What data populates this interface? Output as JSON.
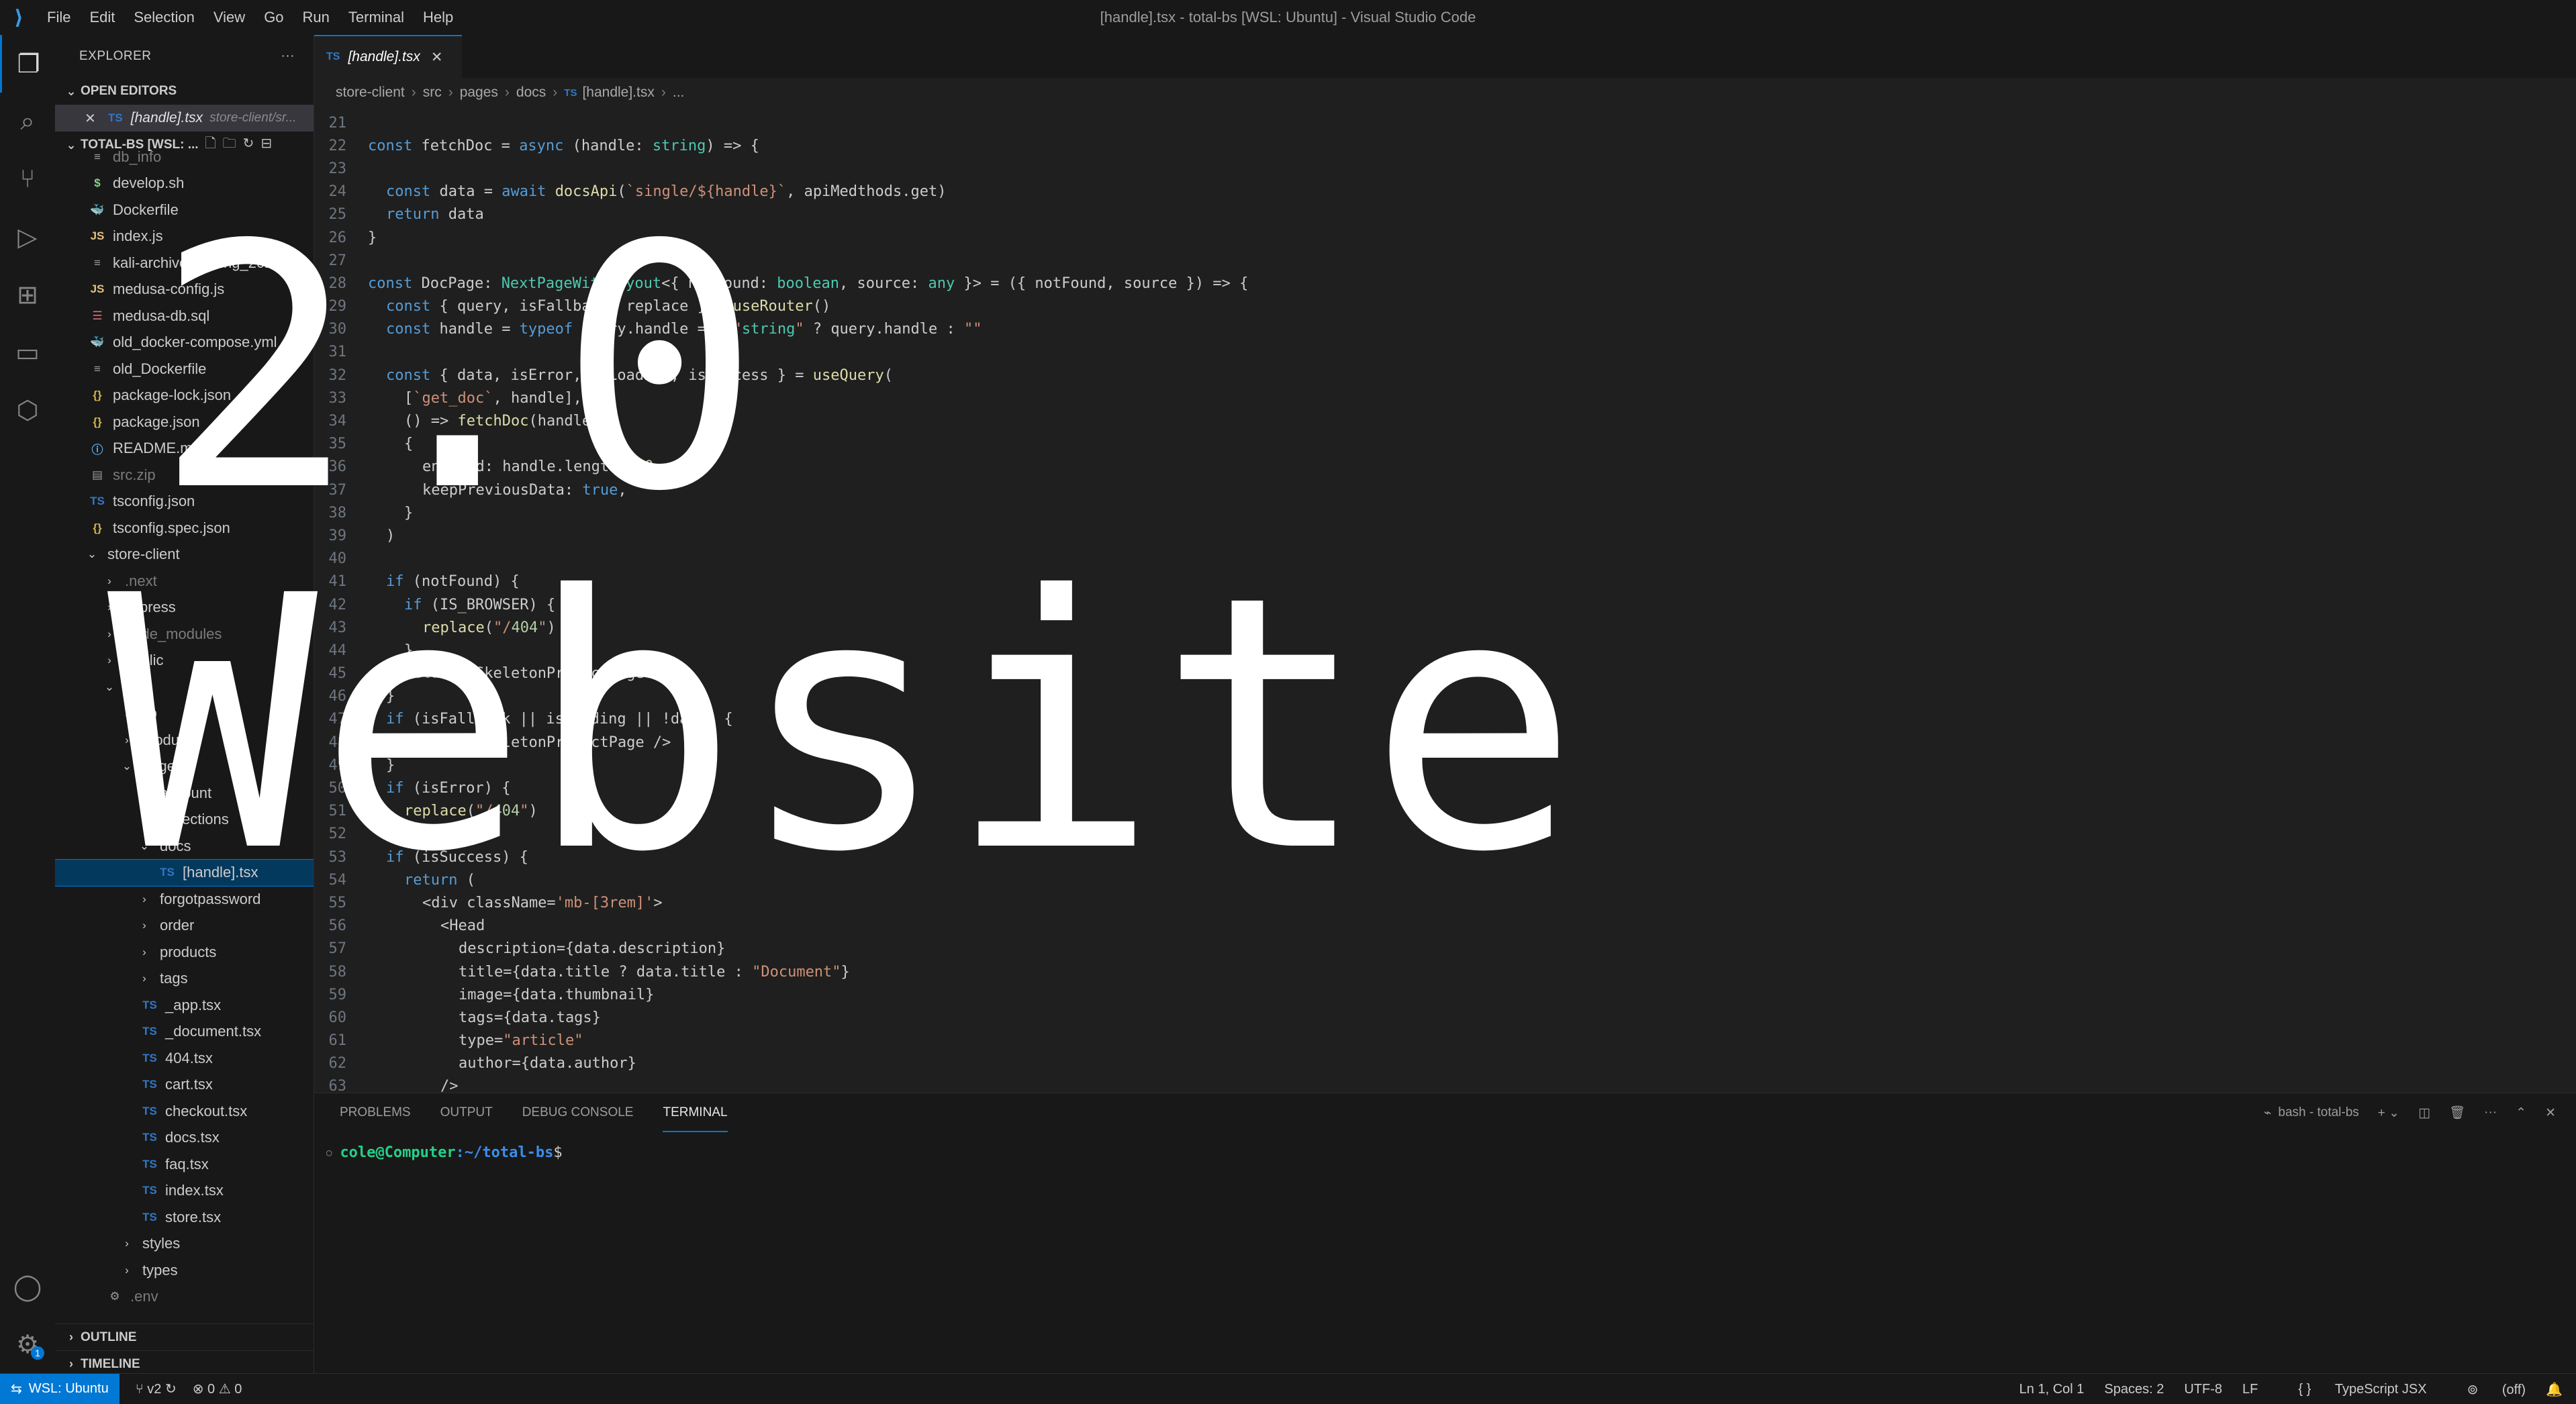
{
  "window": {
    "title": "[handle].tsx - total-bs [WSL: Ubuntu] - Visual Studio Code",
    "menu": [
      "File",
      "Edit",
      "Selection",
      "View",
      "Go",
      "Run",
      "Terminal",
      "Help"
    ]
  },
  "activity_bar": {
    "icons": [
      "explorer-icon",
      "search-icon",
      "source-control-icon",
      "run-debug-icon",
      "extensions-icon",
      "remote-explorer-icon",
      "docker-icon"
    ],
    "bottom_icons": [
      "account-icon",
      "settings-gear-icon"
    ],
    "settings_badge": "1"
  },
  "sidebar": {
    "title": "EXPLORER",
    "more": "···",
    "open_editors_label": "OPEN EDITORS",
    "open_editor": {
      "name": "[handle].tsx",
      "path": "store-client/sr..."
    },
    "workspace_label": "TOTAL-BS [WSL: ...",
    "tree": [
      {
        "name": "db_info",
        "icon": "file",
        "indent": 0,
        "dim": true
      },
      {
        "name": "develop.sh",
        "icon": "sh",
        "indent": 0
      },
      {
        "name": "Dockerfile",
        "icon": "docker",
        "indent": 0
      },
      {
        "name": "index.js",
        "icon": "js",
        "indent": 0
      },
      {
        "name": "kali-archive-keyring_2022...",
        "icon": "file",
        "indent": 0
      },
      {
        "name": "medusa-config.js",
        "icon": "js",
        "indent": 0
      },
      {
        "name": "medusa-db.sql",
        "icon": "sql",
        "indent": 0
      },
      {
        "name": "old_docker-compose.yml",
        "icon": "docker",
        "indent": 0
      },
      {
        "name": "old_Dockerfile",
        "icon": "file",
        "indent": 0
      },
      {
        "name": "package-lock.json",
        "icon": "json",
        "indent": 0
      },
      {
        "name": "package.json",
        "icon": "json",
        "indent": 0
      },
      {
        "name": "README.md",
        "icon": "info",
        "indent": 0
      },
      {
        "name": "src.zip",
        "icon": "zip",
        "indent": 0,
        "dim": true
      },
      {
        "name": "tsconfig.json",
        "icon": "ts",
        "indent": 0
      },
      {
        "name": "tsconfig.spec.json",
        "icon": "json",
        "indent": 0
      },
      {
        "name": "store-client",
        "icon": "folder-open",
        "indent": 0
      },
      {
        "name": ".next",
        "icon": "folder",
        "indent": 1,
        "dim": true
      },
      {
        "name": "cypress",
        "icon": "folder",
        "indent": 1
      },
      {
        "name": "node_modules",
        "icon": "folder",
        "indent": 1,
        "dim": true
      },
      {
        "name": "public",
        "icon": "folder",
        "indent": 1
      },
      {
        "name": "src",
        "icon": "folder-open",
        "indent": 1
      },
      {
        "name": "lib",
        "icon": "folder",
        "indent": 2
      },
      {
        "name": "modules",
        "icon": "folder",
        "indent": 2
      },
      {
        "name": "pages",
        "icon": "folder-open",
        "indent": 2
      },
      {
        "name": "account",
        "icon": "folder",
        "indent": 3
      },
      {
        "name": "collections",
        "icon": "folder",
        "indent": 3
      },
      {
        "name": "docs",
        "icon": "folder-open",
        "indent": 3
      },
      {
        "name": "[handle].tsx",
        "icon": "ts",
        "indent": 4,
        "selected": true
      },
      {
        "name": "forgotpassword",
        "icon": "folder",
        "indent": 3
      },
      {
        "name": "order",
        "icon": "folder",
        "indent": 3
      },
      {
        "name": "products",
        "icon": "folder",
        "indent": 3
      },
      {
        "name": "tags",
        "icon": "folder",
        "indent": 3
      },
      {
        "name": "_app.tsx",
        "icon": "ts",
        "indent": 3
      },
      {
        "name": "_document.tsx",
        "icon": "ts",
        "indent": 3
      },
      {
        "name": "404.tsx",
        "icon": "ts",
        "indent": 3
      },
      {
        "name": "cart.tsx",
        "icon": "ts",
        "indent": 3
      },
      {
        "name": "checkout.tsx",
        "icon": "ts",
        "indent": 3
      },
      {
        "name": "docs.tsx",
        "icon": "ts",
        "indent": 3
      },
      {
        "name": "faq.tsx",
        "icon": "ts",
        "indent": 3
      },
      {
        "name": "index.tsx",
        "icon": "ts",
        "indent": 3
      },
      {
        "name": "store.tsx",
        "icon": "ts",
        "indent": 3
      },
      {
        "name": "styles",
        "icon": "folder",
        "indent": 2
      },
      {
        "name": "types",
        "icon": "folder",
        "indent": 2
      },
      {
        "name": ".env",
        "icon": "gear",
        "indent": 1,
        "dim": true
      }
    ],
    "outline_label": "OUTLINE",
    "timeline_label": "TIMELINE"
  },
  "editor": {
    "tab": {
      "ts_badge": "TS",
      "name": "[handle].tsx"
    },
    "breadcrumb": [
      "store-client",
      "src",
      "pages",
      "docs",
      "[handle].tsx",
      "..."
    ],
    "lines": [
      {
        "n": "21",
        "indent": 0,
        "text": ""
      },
      {
        "n": "22",
        "indent": 0,
        "text": "const fetchDoc = async (handle: string) => {"
      },
      {
        "n": "23",
        "indent": 0,
        "text": ""
      },
      {
        "n": "24",
        "indent": 1,
        "text": "const data = await docsApi(`single/${handle}`, apiMedthods.get)"
      },
      {
        "n": "25",
        "indent": 1,
        "text": "return data"
      },
      {
        "n": "26",
        "indent": 0,
        "text": "}"
      },
      {
        "n": "27",
        "indent": 0,
        "text": ""
      },
      {
        "n": "28",
        "indent": 0,
        "text": "const DocPage: NextPageWithLayout<{ notFound: boolean, source: any }> = ({ notFound, source }) => {"
      },
      {
        "n": "29",
        "indent": 1,
        "text": "const { query, isFallback, replace } = useRouter()"
      },
      {
        "n": "30",
        "indent": 1,
        "text": "const handle = typeof query.handle === \"string\" ? query.handle : \"\""
      },
      {
        "n": "31",
        "indent": 0,
        "text": ""
      },
      {
        "n": "32",
        "indent": 1,
        "text": "const { data, isError, isLoading, isSuccess } = useQuery("
      },
      {
        "n": "33",
        "indent": 2,
        "text": "[`get_doc`, handle],"
      },
      {
        "n": "34",
        "indent": 2,
        "text": "() => fetchDoc(handle),"
      },
      {
        "n": "35",
        "indent": 2,
        "text": "{"
      },
      {
        "n": "36",
        "indent": 3,
        "text": "enabled: handle.length > 0,"
      },
      {
        "n": "37",
        "indent": 3,
        "text": "keepPreviousData: true,"
      },
      {
        "n": "38",
        "indent": 2,
        "text": "}"
      },
      {
        "n": "39",
        "indent": 1,
        "text": ")"
      },
      {
        "n": "40",
        "indent": 0,
        "text": ""
      },
      {
        "n": "41",
        "indent": 1,
        "text": "if (notFound) {"
      },
      {
        "n": "42",
        "indent": 2,
        "text": "if (IS_BROWSER) {"
      },
      {
        "n": "43",
        "indent": 3,
        "text": "replace(\"/404\")"
      },
      {
        "n": "44",
        "indent": 2,
        "text": "}"
      },
      {
        "n": "45",
        "indent": 2,
        "text": "return <SkeletonProductPage />"
      },
      {
        "n": "46",
        "indent": 1,
        "text": "}"
      },
      {
        "n": "47",
        "indent": 1,
        "text": "if (isFallback || isLoading || !data) {"
      },
      {
        "n": "48",
        "indent": 2,
        "text": "return <SkeletonProductPage />"
      },
      {
        "n": "49",
        "indent": 1,
        "text": "}"
      },
      {
        "n": "50",
        "indent": 1,
        "text": "if (isError) {"
      },
      {
        "n": "51",
        "indent": 2,
        "text": "replace(\"/404\")"
      },
      {
        "n": "52",
        "indent": 1,
        "text": "}"
      },
      {
        "n": "53",
        "indent": 1,
        "text": "if (isSuccess) {"
      },
      {
        "n": "54",
        "indent": 2,
        "text": "return ("
      },
      {
        "n": "55",
        "indent": 3,
        "text": "<div className='mb-[3rem]'>"
      },
      {
        "n": "56",
        "indent": 4,
        "text": "<Head"
      },
      {
        "n": "57",
        "indent": 5,
        "text": "description={data.description}"
      },
      {
        "n": "58",
        "indent": 5,
        "text": "title={data.title ? data.title : \"Document\"}"
      },
      {
        "n": "59",
        "indent": 5,
        "text": "image={data.thumbnail}"
      },
      {
        "n": "60",
        "indent": 5,
        "text": "tags={data.tags}"
      },
      {
        "n": "61",
        "indent": 5,
        "text": "type=\"article\""
      },
      {
        "n": "62",
        "indent": 5,
        "text": "author={data.author}"
      },
      {
        "n": "63",
        "indent": 4,
        "text": "/>"
      }
    ]
  },
  "panel": {
    "tabs": [
      "PROBLEMS",
      "OUTPUT",
      "DEBUG CONSOLE",
      "TERMINAL"
    ],
    "active_tab": "TERMINAL",
    "terminal_name": "bash - total-bs",
    "prompt_user": "cole@Computer",
    "prompt_path": ":~/total-bs",
    "prompt_symbol": "$"
  },
  "statusbar": {
    "remote": "WSL: Ubuntu",
    "branch": "v2",
    "problems": "⊗ 0 ⚠ 0",
    "position": "Ln 1, Col 1",
    "spaces": "Spaces: 2",
    "encoding": "UTF-8",
    "eol": "LF",
    "language": "TypeScript JSX",
    "port": "(off)"
  },
  "overlay": {
    "line1": "2.0",
    "line2": "Website"
  }
}
